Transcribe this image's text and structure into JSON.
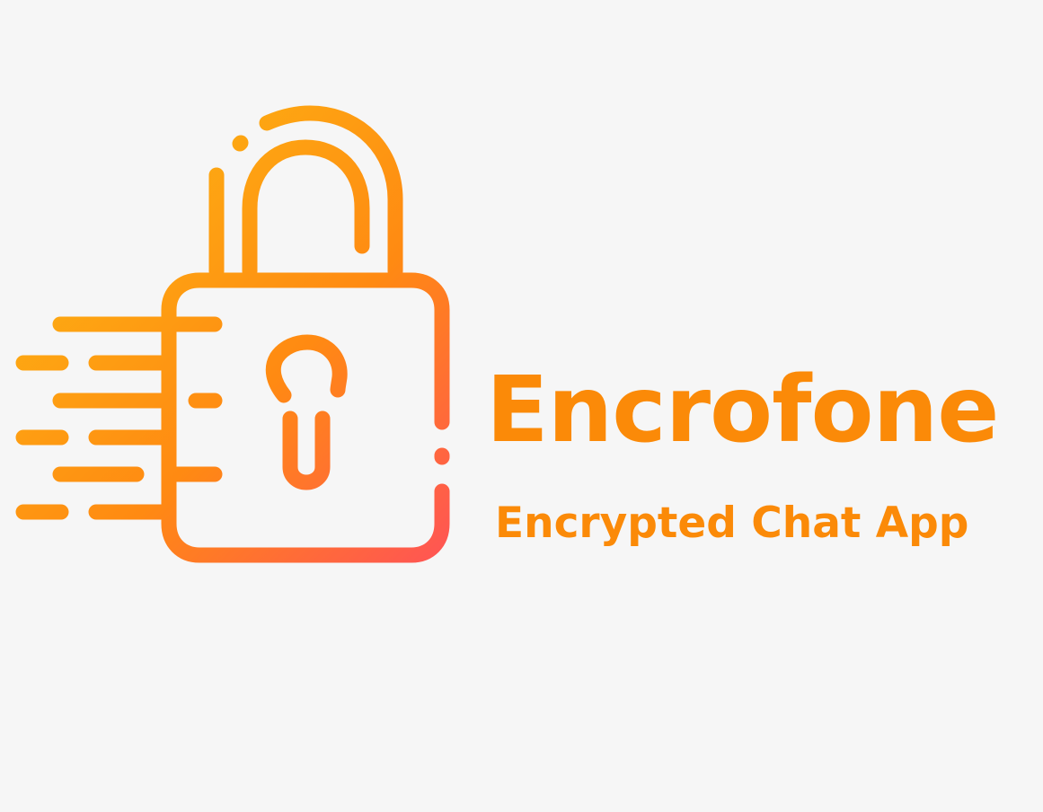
{
  "brand": {
    "name": "Encrofone",
    "tagline": "Encrypted Chat App"
  },
  "colors": {
    "background": "#f6f6f6",
    "text": "#fb8a08",
    "gradient_start": "#fcb912",
    "gradient_mid": "#ff8a12",
    "gradient_end": "#ff4f5b"
  },
  "icons": {
    "logo": "padlock-with-speed-lines-icon"
  }
}
